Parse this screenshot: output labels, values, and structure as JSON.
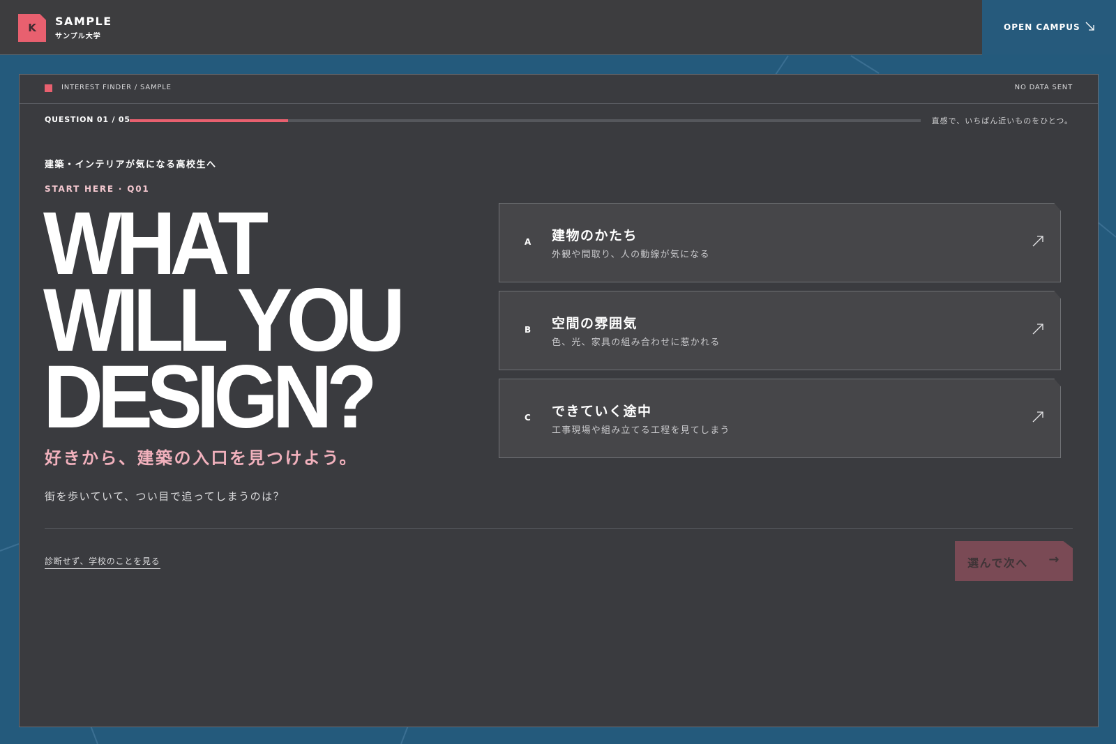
{
  "header": {
    "logo_letter": "K",
    "school_name": "SAMPLE",
    "school_name_ja": "サンプル大学",
    "open_campus_label": "OPEN CAMPUS"
  },
  "finder": {
    "section_label": "INTEREST FINDER / SAMPLE",
    "privacy_note": "NO DATA SENT",
    "question_counter": "QUESTION 01 / 05",
    "progress_fraction": 0.2,
    "hint": "直感で、いちばん近いものをひとつ。"
  },
  "intro": {
    "eyebrow": "建築・インテリアが気になる高校生へ",
    "start_here": "START HERE · Q01",
    "headline": [
      "WHAT",
      "WILL YOU",
      "DESIGN?"
    ],
    "tagline": "好きから、建築の入口を見つけよう。",
    "question": "街を歩いていて、つい目で追ってしまうのは？"
  },
  "options": [
    {
      "letter": "A",
      "title": "建物のかたち",
      "desc": "外観や間取り、人の動線が気になる"
    },
    {
      "letter": "B",
      "title": "空間の雰囲気",
      "desc": "色、光、家具の組み合わせに惹かれる"
    },
    {
      "letter": "C",
      "title": "できていく途中",
      "desc": "工事現場や組み立てる工程を見てしまう"
    }
  ],
  "footer": {
    "skip_link": "診断せず、学校のことを見る",
    "next_button": "選んで次へ",
    "next_arrow": "→"
  },
  "colors": {
    "accent": "#e8606f",
    "background": "#245a7c",
    "panel": "#3a3b3f",
    "tagline": "#f2b1bd"
  }
}
